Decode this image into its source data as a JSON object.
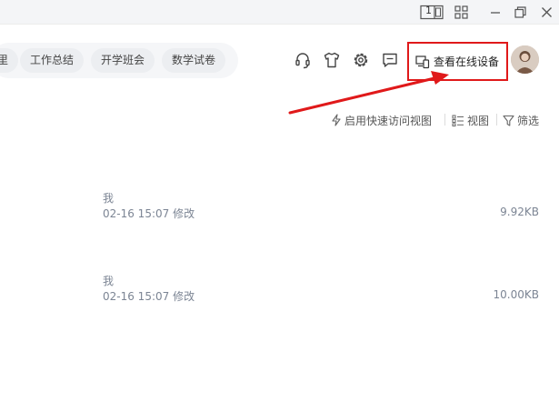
{
  "titlebar": {
    "controls": [
      {
        "name": "layout-toggle-icon"
      },
      {
        "name": "grid-apps-icon"
      },
      {
        "name": "minimize-icon"
      },
      {
        "name": "restore-icon"
      },
      {
        "name": "close-icon"
      }
    ],
    "layout_badge": "1"
  },
  "tags": [
    {
      "label": "里"
    },
    {
      "label": "工作总结"
    },
    {
      "label": "开学班会"
    },
    {
      "label": "数学试卷"
    }
  ],
  "header": {
    "icons": [
      "headset-icon",
      "tshirt-icon",
      "gear-icon",
      "message-icon"
    ],
    "device_button": {
      "label": "查看在线设备",
      "icon": "devices-icon"
    },
    "annotation_color": "#e0191a"
  },
  "toolbar": {
    "quick_access": "启用快速访问视图",
    "view": "视图",
    "filter": "筛选"
  },
  "files": [
    {
      "owner": "我",
      "modified": "02-16 15:07 修改",
      "size": "9.92KB"
    },
    {
      "owner": "我",
      "modified": "02-16 15:07 修改",
      "size": "10.00KB"
    }
  ]
}
